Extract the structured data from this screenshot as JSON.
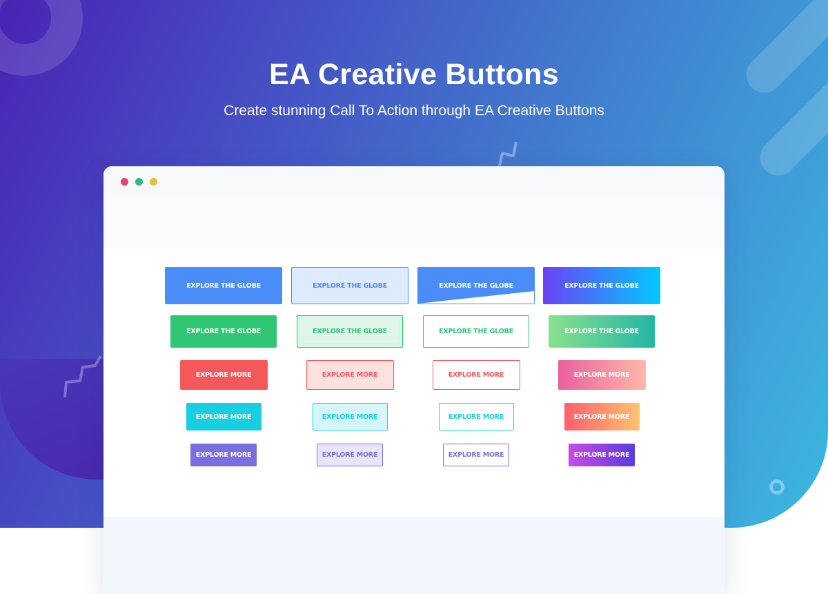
{
  "hero": {
    "title": "EA Creative Buttons",
    "subtitle": "Create stunning Call To Action through EA Creative Buttons"
  },
  "colors": {
    "bg_gradient": [
      "#4a23b4",
      "#4552c4",
      "#4180cf",
      "#3cb8e0"
    ],
    "window_dots": [
      "#e0476a",
      "#2cbd7a",
      "#e6c232"
    ]
  },
  "button_rows": [
    {
      "label": "EXPLORE THE GLOBE",
      "buttons": [
        {
          "style": "solid",
          "color": "#4a8df8"
        },
        {
          "style": "light",
          "color": "#4a8df8"
        },
        {
          "style": "slant",
          "color": "#4a8df8"
        },
        {
          "style": "gradient",
          "gradient": [
            "#6a42f5",
            "#00c9ff"
          ]
        }
      ]
    },
    {
      "label": "EXPLORE THE GLOBE",
      "buttons": [
        {
          "style": "solid",
          "color": "#2ec673"
        },
        {
          "style": "light-inner",
          "color": "#2ec673"
        },
        {
          "style": "outline",
          "color": "#2ec673"
        },
        {
          "style": "gradient",
          "gradient": [
            "#8be08e",
            "#21b7a4"
          ]
        }
      ]
    },
    {
      "label": "EXPLORE MORE",
      "buttons": [
        {
          "style": "solid",
          "color": "#f5585b"
        },
        {
          "style": "light",
          "color": "#f5585b"
        },
        {
          "style": "outline",
          "color": "#f5585b"
        },
        {
          "style": "gradient",
          "gradient": [
            "#e9609e",
            "#ffb8a8"
          ]
        }
      ]
    },
    {
      "label": "EXPLORE MORE",
      "buttons": [
        {
          "style": "solid",
          "color": "#17cfe0"
        },
        {
          "style": "light",
          "color": "#17cfe0"
        },
        {
          "style": "outline",
          "color": "#17cfe0"
        },
        {
          "style": "gradient",
          "gradient": [
            "#ff5f6d",
            "#ffc371"
          ]
        }
      ]
    },
    {
      "label": "EXPLORE MORE",
      "buttons": [
        {
          "style": "solid",
          "color": "#7a6ee0"
        },
        {
          "style": "light",
          "color": "#7a6ee0"
        },
        {
          "style": "outline",
          "color": "#7a6ee0"
        },
        {
          "style": "gradient",
          "gradient": [
            "#c94be6",
            "#5a3be0"
          ]
        }
      ]
    }
  ]
}
